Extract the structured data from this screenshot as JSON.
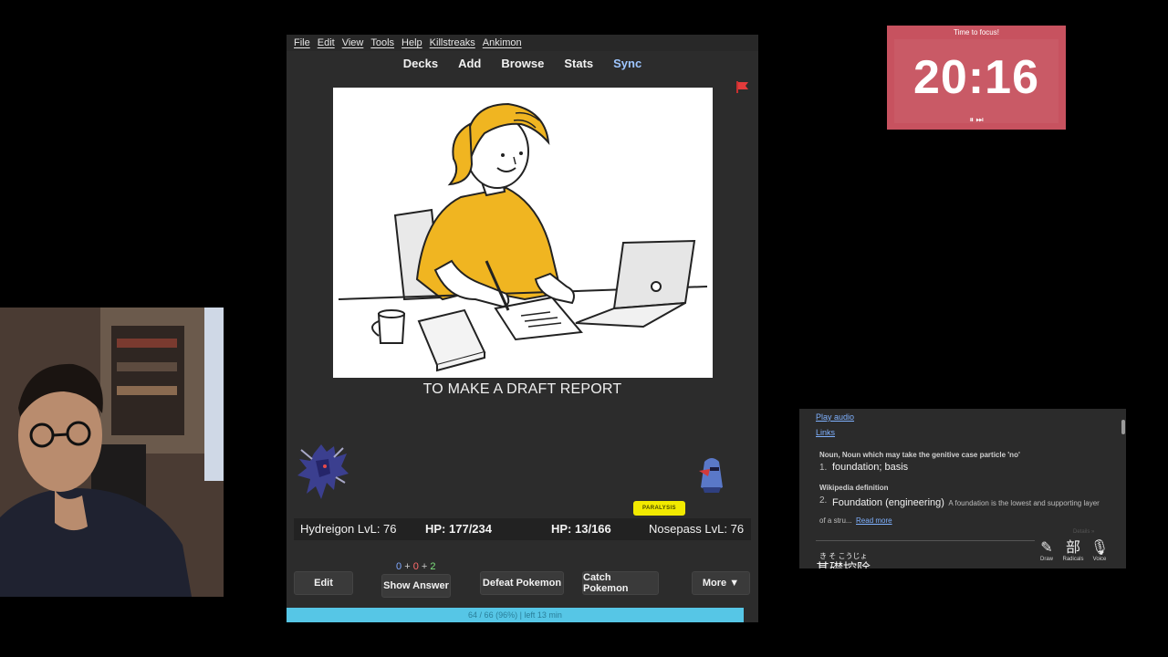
{
  "menu": [
    "File",
    "Edit",
    "View",
    "Tools",
    "Help",
    "Killstreaks",
    "Ankimon"
  ],
  "toolbar": [
    "Decks",
    "Add",
    "Browse",
    "Stats",
    "Sync"
  ],
  "card": {
    "text": "TO MAKE A DRAFT REPORT",
    "flag_color": "#e23b3b"
  },
  "battle": {
    "player_name": "Hydreigon LvL: 76",
    "player_hp": "HP: 177/234",
    "enemy_hp": "HP: 13/166",
    "enemy_name": "Nosepass LvL: 76",
    "status": "PARALYSIS"
  },
  "counts": {
    "new": "0",
    "learn": "0",
    "review": "2",
    "plus": "+"
  },
  "buttons": {
    "edit": "Edit",
    "show_answer": "Show Answer",
    "defeat": "Defeat Pokemon",
    "catch": "Catch Pokemon",
    "more": "More ▼"
  },
  "progress": {
    "text": "64 / 66 (96%) | left 13 min",
    "fraction": 0.96
  },
  "timer": {
    "label": "Time to focus!",
    "time": "20:16",
    "controls": "⏸ ⏭"
  },
  "dictionary": {
    "play_audio": "Play audio",
    "links": "Links",
    "pos": "Noun, Noun which may take the genitive case particle 'no'",
    "m1_num": "1.",
    "m1": "foundation; basis",
    "wiki_label": "Wikipedia definition",
    "m2_num": "2.",
    "m2": "Foundation (engineering)",
    "m2_desc": "A foundation is the lowest and supporting layer of a stru...",
    "read_more": "Read more",
    "details": "Details »",
    "reading": "き そ こうじょ",
    "word": "基礎控除",
    "tools": [
      {
        "glyph": "✎",
        "label": "Draw"
      },
      {
        "glyph": "部",
        "label": "Radicals"
      },
      {
        "glyph": "🎙",
        "label": "Voice"
      }
    ]
  }
}
